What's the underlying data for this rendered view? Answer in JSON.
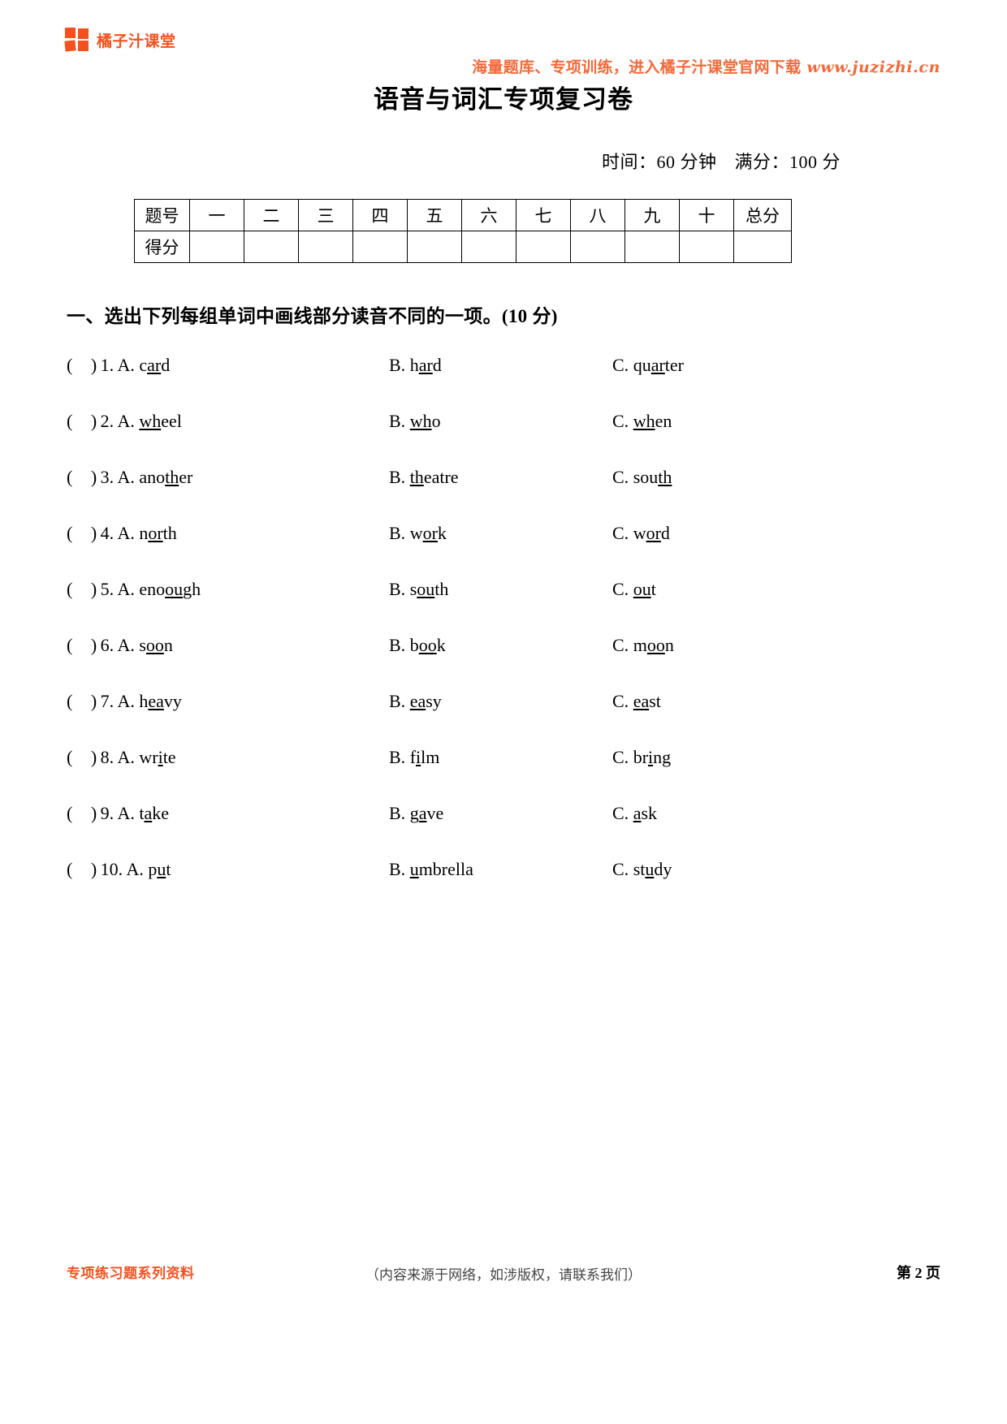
{
  "header": {
    "brand_name": "橘子汁课堂",
    "logo_icon": "four-square-grid-icon",
    "logo_color": "#F4511E",
    "tagline_text": "海量题库、专项训练，进入橘子汁课堂官网下载",
    "tagline_url": "www.juzizhi.cn",
    "tagline_color": "#F4693A"
  },
  "title": "语音与词汇专项复习卷",
  "meta": {
    "time_label": "时间：60 分钟",
    "score_label": "满分：100 分"
  },
  "score_table": {
    "row_label_1": "题号",
    "row_label_2": "得分",
    "columns": [
      "一",
      "二",
      "三",
      "四",
      "五",
      "六",
      "七",
      "八",
      "九",
      "十"
    ],
    "total_label": "总分",
    "scores": [
      "",
      "",
      "",
      "",
      "",
      "",
      "",
      "",
      "",
      "",
      ""
    ]
  },
  "section": {
    "heading": "一、选出下列每组单词中画线部分读音不同的一项。(10 分)"
  },
  "questions": [
    {
      "number": "1.",
      "a": {
        "label": "A.",
        "pre": "c",
        "mark": "ar",
        "post": "d"
      },
      "b": {
        "label": "B.",
        "pre": "h",
        "mark": "ar",
        "post": "d"
      },
      "c": {
        "label": "C.",
        "pre": "qu",
        "mark": "ar",
        "post": "ter"
      }
    },
    {
      "number": "2.",
      "a": {
        "label": "A.",
        "pre": "",
        "mark": "wh",
        "post": "eel"
      },
      "b": {
        "label": "B.",
        "pre": "",
        "mark": "wh",
        "post": "o"
      },
      "c": {
        "label": "C.",
        "pre": "",
        "mark": "wh",
        "post": "en"
      }
    },
    {
      "number": "3.",
      "a": {
        "label": "A.",
        "pre": "ano",
        "mark": "th",
        "post": "er"
      },
      "b": {
        "label": "B.",
        "pre": "",
        "mark": "th",
        "post": "eatre"
      },
      "c": {
        "label": "C.",
        "pre": "sou",
        "mark": "th",
        "post": ""
      }
    },
    {
      "number": "4.",
      "a": {
        "label": "A.",
        "pre": "n",
        "mark": "or",
        "post": "th"
      },
      "b": {
        "label": "B.",
        "pre": "w",
        "mark": "or",
        "post": "k"
      },
      "c": {
        "label": "C.",
        "pre": "w",
        "mark": "or",
        "post": "d"
      }
    },
    {
      "number": "5.",
      "a": {
        "label": "A.",
        "pre": "eno",
        "mark": "ou",
        "post": "gh"
      },
      "b": {
        "label": "B.",
        "pre": "s",
        "mark": "ou",
        "post": "th"
      },
      "c": {
        "label": "C.",
        "pre": "",
        "mark": "ou",
        "post": "t"
      }
    },
    {
      "number": "6.",
      "a": {
        "label": "A.",
        "pre": "s",
        "mark": "oo",
        "post": "n"
      },
      "b": {
        "label": "B.",
        "pre": "b",
        "mark": "oo",
        "post": "k"
      },
      "c": {
        "label": "C.",
        "pre": "m",
        "mark": "oo",
        "post": "n"
      }
    },
    {
      "number": "7.",
      "a": {
        "label": "A.",
        "pre": "h",
        "mark": "ea",
        "post": "vy"
      },
      "b": {
        "label": "B.",
        "pre": "",
        "mark": "ea",
        "post": "sy"
      },
      "c": {
        "label": "C.",
        "pre": "",
        "mark": "ea",
        "post": "st"
      }
    },
    {
      "number": "8.",
      "a": {
        "label": "A.",
        "pre": "wr",
        "mark": "i",
        "post": "te"
      },
      "b": {
        "label": "B.",
        "pre": "f",
        "mark": "i",
        "post": "lm"
      },
      "c": {
        "label": "C.",
        "pre": "br",
        "mark": "i",
        "post": "ng"
      }
    },
    {
      "number": "9.",
      "a": {
        "label": "A.",
        "pre": "t",
        "mark": "a",
        "post": "ke"
      },
      "b": {
        "label": "B.",
        "pre": "g",
        "mark": "a",
        "post": "ve"
      },
      "c": {
        "label": "C.",
        "pre": "",
        "mark": "a",
        "post": "sk"
      }
    },
    {
      "number": "10.",
      "a": {
        "label": "A.",
        "pre": "p",
        "mark": "u",
        "post": "t"
      },
      "b": {
        "label": "B.",
        "pre": "",
        "mark": "u",
        "post": "mbrella"
      },
      "c": {
        "label": "C.",
        "pre": "st",
        "mark": "u",
        "post": "dy"
      }
    }
  ],
  "footer": {
    "left_text": "专项练习题系列资料",
    "center_text": "（内容来源于网络，如涉版权，请联系我们）",
    "page_label": "第 2 页"
  }
}
